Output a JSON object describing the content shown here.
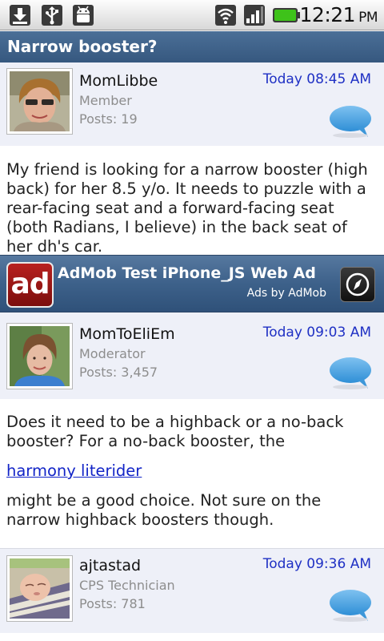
{
  "status_bar": {
    "icons": [
      "download-icon",
      "usb-icon",
      "android-debug-icon",
      "wifi-icon",
      "signal-icon",
      "battery-icon"
    ],
    "time": "12:21",
    "ampm": "PM"
  },
  "thread": {
    "title": "Narrow booster?"
  },
  "posts": [
    {
      "username": "MomLibbe",
      "role": "Member",
      "posts": "Posts: 19",
      "timestamp": "Today 08:45 AM",
      "body": "My friend is looking for a narrow booster (high back) for her 8.5 y/o. It needs to puzzle with a rear-facing seat and a forward-facing seat (both Radians, I believe) in the back seat of her dh's car."
    },
    {
      "username": "MomToEliEm",
      "role": "Moderator",
      "posts": "Posts: 3,457",
      "timestamp": "Today 09:03 AM",
      "body_before": "Does it need to be a highback or a no-back booster? For a no-back booster, the",
      "link": "harmony literider",
      "body_after": "might be a good choice. Not sure on the narrow highback boosters though."
    },
    {
      "username": "ajtastad",
      "role": "CPS Technician",
      "posts": "Posts: 781",
      "timestamp": "Today 09:36 AM"
    }
  ],
  "ad": {
    "logo": "ad",
    "title": "AdMob Test iPhone_JS Web Ad",
    "by": "Ads by AdMob"
  },
  "colors": {
    "title_bar": "#3f628a",
    "post_header_bg": "#eef0f8",
    "timestamp": "#1f30c4",
    "link": "#1224c7",
    "ad_logo": "#a01a18"
  }
}
